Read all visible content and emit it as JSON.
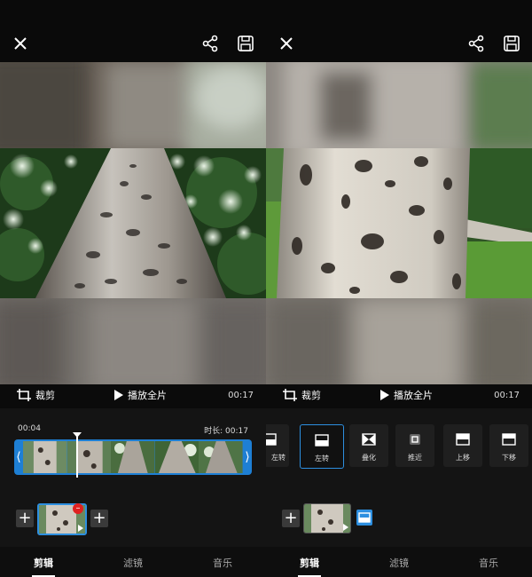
{
  "left": {
    "crop_label": "裁剪",
    "play_label": "播放全片",
    "duration": "00:17",
    "current_time": "00:04",
    "total_label": "时长: 00:17",
    "tabs": [
      {
        "label": "剪辑",
        "active": true
      },
      {
        "label": "滤镜",
        "active": false
      },
      {
        "label": "音乐",
        "active": false
      }
    ]
  },
  "right": {
    "crop_label": "裁剪",
    "play_label": "播放全片",
    "duration": "00:17",
    "transitions": [
      {
        "label": "左转",
        "icon": "cut-right-icon",
        "partial": true
      },
      {
        "label": "左转",
        "icon": "slide-left-icon",
        "selected": true
      },
      {
        "label": "叠化",
        "icon": "dissolve-icon"
      },
      {
        "label": "推近",
        "icon": "zoom-in-icon"
      },
      {
        "label": "上移",
        "icon": "slide-up-icon"
      },
      {
        "label": "下移",
        "icon": "slide-down-icon"
      }
    ],
    "tabs": [
      {
        "label": "剪辑",
        "active": true
      },
      {
        "label": "滤镜",
        "active": false
      },
      {
        "label": "音乐",
        "active": false
      }
    ]
  },
  "colors": {
    "accent": "#2d8fe0",
    "remove": "#e02020",
    "background": "#0b0b0b"
  }
}
